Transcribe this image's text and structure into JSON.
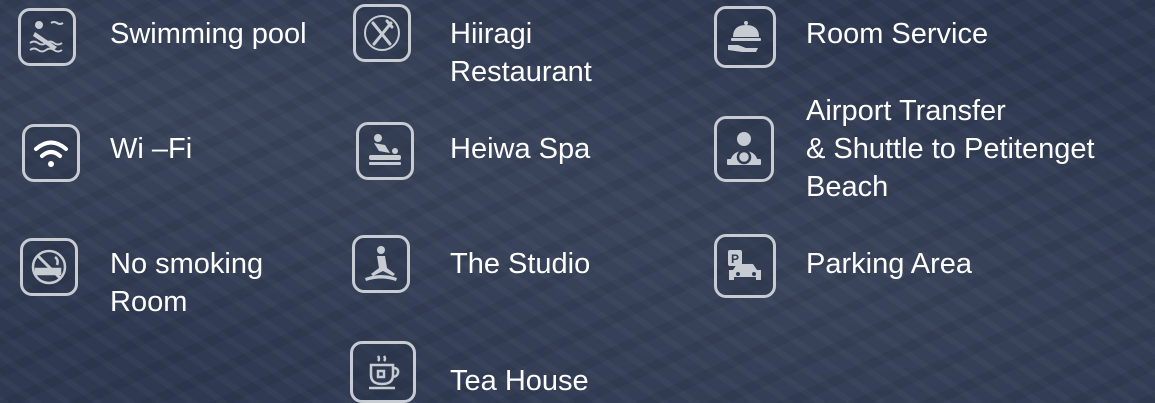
{
  "amenities": {
    "swimming_pool": "Swimming pool",
    "wifi": "Wi –Fi",
    "no_smoking": "No smoking\nRoom",
    "restaurant": "Hiiragi\nRestaurant",
    "spa": "Heiwa Spa",
    "studio": "The Studio",
    "tea_house": "Tea House",
    "room_service": "Room Service",
    "airport_transfer": "Airport Transfer\n& Shuttle to Petitenget\nBeach",
    "parking": "Parking Area"
  },
  "icons": {
    "swimming_pool": "swimmer-icon",
    "wifi": "wifi-icon",
    "no_smoking": "no-smoking-icon",
    "restaurant": "fork-knife-icon",
    "spa": "massage-icon",
    "studio": "yoga-icon",
    "tea_house": "tea-cup-icon",
    "room_service": "cloche-icon",
    "airport_transfer": "driver-icon",
    "parking": "parking-car-icon"
  },
  "colors": {
    "background": "#2f3a52",
    "icon_border": "#c7cbd2",
    "text": "#ffffff"
  }
}
